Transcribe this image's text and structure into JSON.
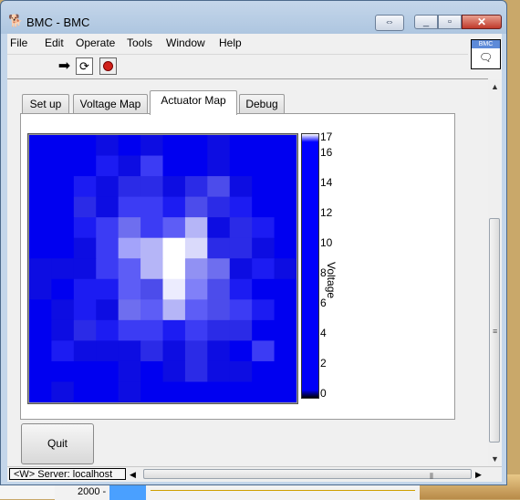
{
  "window": {
    "title": "BMC - BMC",
    "restore_alt_glyph": "⇔",
    "minimize_glyph": "▭",
    "maximize_glyph": "▭",
    "close_glyph": "✕"
  },
  "menu": [
    "File",
    "Edit",
    "Operate",
    "Tools",
    "Window",
    "Help"
  ],
  "vi_icon": {
    "label": "BMC"
  },
  "tabs": [
    {
      "label": "Set up",
      "active": false
    },
    {
      "label": "Voltage Map",
      "active": false
    },
    {
      "label": "Actuator Map",
      "active": true
    },
    {
      "label": "Debug",
      "active": false
    }
  ],
  "colorbar": {
    "ticks": [
      "17",
      "16",
      "14",
      "12",
      "10",
      "8",
      "6",
      "4",
      "2",
      "0"
    ],
    "label": "Voltage"
  },
  "actuator_map": {
    "rows": 12,
    "cols": 12,
    "max": 17,
    "values": [
      [
        2,
        2,
        2,
        3,
        2,
        3,
        2,
        2,
        3,
        2,
        2,
        2
      ],
      [
        2,
        2,
        2,
        4,
        3,
        6,
        2,
        2,
        3,
        2,
        2,
        2
      ],
      [
        2,
        2,
        4,
        3,
        5,
        5,
        3,
        5,
        7,
        3,
        2,
        2
      ],
      [
        2,
        2,
        5,
        3,
        6,
        6,
        4,
        7,
        5,
        4,
        2,
        2
      ],
      [
        2,
        2,
        4,
        6,
        9,
        6,
        8,
        13,
        3,
        5,
        4,
        2
      ],
      [
        2,
        2,
        3,
        6,
        12,
        13,
        17,
        15,
        5,
        5,
        3,
        2
      ],
      [
        3,
        3,
        3,
        6,
        8,
        13,
        17,
        11,
        9,
        3,
        4,
        3
      ],
      [
        3,
        2,
        4,
        4,
        8,
        7,
        16,
        10,
        7,
        4,
        2,
        2
      ],
      [
        2,
        3,
        4,
        3,
        9,
        8,
        13,
        8,
        7,
        6,
        4,
        2
      ],
      [
        2,
        3,
        5,
        4,
        6,
        6,
        4,
        6,
        5,
        5,
        2,
        2
      ],
      [
        2,
        4,
        3,
        3,
        3,
        5,
        3,
        5,
        3,
        2,
        6,
        2
      ],
      [
        2,
        2,
        2,
        2,
        3,
        2,
        3,
        5,
        3,
        3,
        2,
        2
      ],
      [
        2,
        3,
        2,
        2,
        3,
        2,
        2,
        2,
        2,
        2,
        2,
        2
      ]
    ]
  },
  "quit_label": "Quit",
  "status": {
    "server": "<W> Server: localhost"
  },
  "background": {
    "axis_tick": "2000 -"
  }
}
